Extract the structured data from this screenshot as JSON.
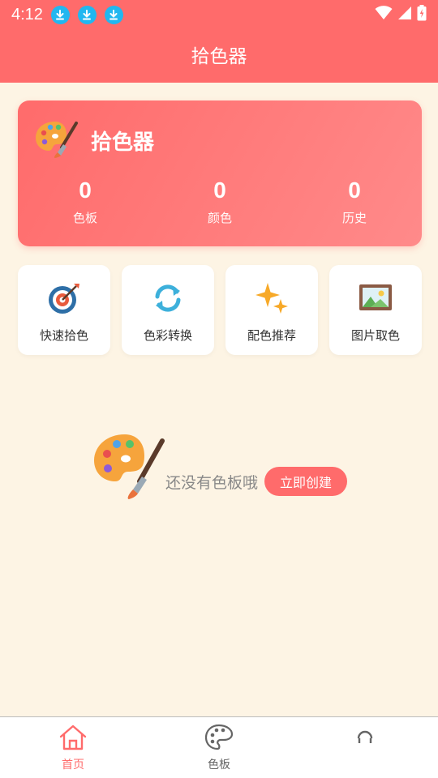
{
  "status_bar": {
    "time": "4:12",
    "notifications": [
      "download-icon",
      "download-icon",
      "download-icon"
    ],
    "icons": [
      "wifi-icon",
      "signal-icon",
      "battery-icon"
    ]
  },
  "app_bar": {
    "title": "拾色器"
  },
  "summary": {
    "title": "拾色器",
    "stats": [
      {
        "value": "0",
        "label": "色板"
      },
      {
        "value": "0",
        "label": "颜色"
      },
      {
        "value": "0",
        "label": "历史"
      }
    ]
  },
  "features": [
    {
      "label": "快速拾色",
      "icon": "target-icon"
    },
    {
      "label": "色彩转换",
      "icon": "refresh-icon"
    },
    {
      "label": "配色推荐",
      "icon": "sparkle-icon"
    },
    {
      "label": "图片取色",
      "icon": "picture-icon"
    }
  ],
  "empty_state": {
    "message": "还没有色板哦",
    "button": "立即创建"
  },
  "bottom_nav": [
    {
      "label": "首页",
      "icon": "home-icon",
      "active": true
    },
    {
      "label": "色板",
      "icon": "palette-icon",
      "active": false
    },
    {
      "label": "",
      "icon": "profile-icon",
      "active": false
    }
  ],
  "colors": {
    "primary": "#FF6B6B",
    "background": "#FDF4E4"
  }
}
